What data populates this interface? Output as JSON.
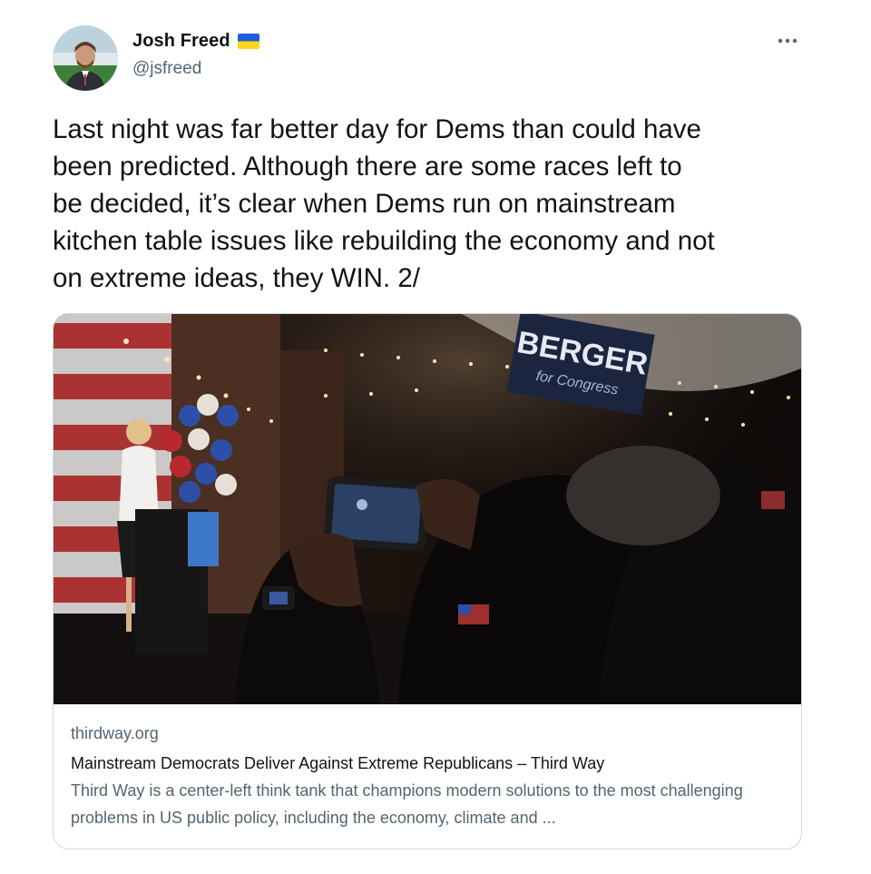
{
  "author": {
    "display_name": "Josh Freed",
    "handle": "@jsfreed",
    "flag_icon": "ukraine-flag-icon",
    "verified_colors": {
      "flag_blue": "#1f5fd6",
      "flag_yellow": "#f9d616"
    }
  },
  "menu": {
    "more_icon": "more-horizontal-icon"
  },
  "tweet": {
    "text": "Last night was far better day for Dems than could have\nbeen predicted. Although there are some races left to\nbe decided, it’s clear when Dems run on mainstream\nkitchen table issues like rebuilding the economy and not\non extreme ideas, they WIN. 2/"
  },
  "card": {
    "image_sign_text": "BERGER",
    "image_sign_subtext": "for Congress",
    "domain": "thirdway.org",
    "title": "Mainstream Democrats Deliver Against Extreme Republicans – Third Way",
    "description": "Third Way is a center-left think tank that champions modern solutions to the most challenging problems in US public policy, including the economy, climate and ..."
  },
  "colors": {
    "text": "#0f1419",
    "secondary": "#536471",
    "border": "#cfd9de"
  }
}
